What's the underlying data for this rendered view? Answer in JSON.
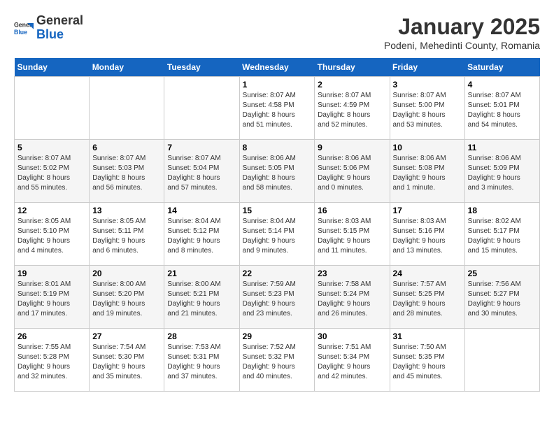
{
  "logo": {
    "general": "General",
    "blue": "Blue"
  },
  "title": "January 2025",
  "subtitle": "Podeni, Mehedinti County, Romania",
  "weekdays": [
    "Sunday",
    "Monday",
    "Tuesday",
    "Wednesday",
    "Thursday",
    "Friday",
    "Saturday"
  ],
  "weeks": [
    [
      {
        "day": "",
        "info": ""
      },
      {
        "day": "",
        "info": ""
      },
      {
        "day": "",
        "info": ""
      },
      {
        "day": "1",
        "info": "Sunrise: 8:07 AM\nSunset: 4:58 PM\nDaylight: 8 hours\nand 51 minutes."
      },
      {
        "day": "2",
        "info": "Sunrise: 8:07 AM\nSunset: 4:59 PM\nDaylight: 8 hours\nand 52 minutes."
      },
      {
        "day": "3",
        "info": "Sunrise: 8:07 AM\nSunset: 5:00 PM\nDaylight: 8 hours\nand 53 minutes."
      },
      {
        "day": "4",
        "info": "Sunrise: 8:07 AM\nSunset: 5:01 PM\nDaylight: 8 hours\nand 54 minutes."
      }
    ],
    [
      {
        "day": "5",
        "info": "Sunrise: 8:07 AM\nSunset: 5:02 PM\nDaylight: 8 hours\nand 55 minutes."
      },
      {
        "day": "6",
        "info": "Sunrise: 8:07 AM\nSunset: 5:03 PM\nDaylight: 8 hours\nand 56 minutes."
      },
      {
        "day": "7",
        "info": "Sunrise: 8:07 AM\nSunset: 5:04 PM\nDaylight: 8 hours\nand 57 minutes."
      },
      {
        "day": "8",
        "info": "Sunrise: 8:06 AM\nSunset: 5:05 PM\nDaylight: 8 hours\nand 58 minutes."
      },
      {
        "day": "9",
        "info": "Sunrise: 8:06 AM\nSunset: 5:06 PM\nDaylight: 9 hours\nand 0 minutes."
      },
      {
        "day": "10",
        "info": "Sunrise: 8:06 AM\nSunset: 5:08 PM\nDaylight: 9 hours\nand 1 minute."
      },
      {
        "day": "11",
        "info": "Sunrise: 8:06 AM\nSunset: 5:09 PM\nDaylight: 9 hours\nand 3 minutes."
      }
    ],
    [
      {
        "day": "12",
        "info": "Sunrise: 8:05 AM\nSunset: 5:10 PM\nDaylight: 9 hours\nand 4 minutes."
      },
      {
        "day": "13",
        "info": "Sunrise: 8:05 AM\nSunset: 5:11 PM\nDaylight: 9 hours\nand 6 minutes."
      },
      {
        "day": "14",
        "info": "Sunrise: 8:04 AM\nSunset: 5:12 PM\nDaylight: 9 hours\nand 8 minutes."
      },
      {
        "day": "15",
        "info": "Sunrise: 8:04 AM\nSunset: 5:14 PM\nDaylight: 9 hours\nand 9 minutes."
      },
      {
        "day": "16",
        "info": "Sunrise: 8:03 AM\nSunset: 5:15 PM\nDaylight: 9 hours\nand 11 minutes."
      },
      {
        "day": "17",
        "info": "Sunrise: 8:03 AM\nSunset: 5:16 PM\nDaylight: 9 hours\nand 13 minutes."
      },
      {
        "day": "18",
        "info": "Sunrise: 8:02 AM\nSunset: 5:17 PM\nDaylight: 9 hours\nand 15 minutes."
      }
    ],
    [
      {
        "day": "19",
        "info": "Sunrise: 8:01 AM\nSunset: 5:19 PM\nDaylight: 9 hours\nand 17 minutes."
      },
      {
        "day": "20",
        "info": "Sunrise: 8:00 AM\nSunset: 5:20 PM\nDaylight: 9 hours\nand 19 minutes."
      },
      {
        "day": "21",
        "info": "Sunrise: 8:00 AM\nSunset: 5:21 PM\nDaylight: 9 hours\nand 21 minutes."
      },
      {
        "day": "22",
        "info": "Sunrise: 7:59 AM\nSunset: 5:23 PM\nDaylight: 9 hours\nand 23 minutes."
      },
      {
        "day": "23",
        "info": "Sunrise: 7:58 AM\nSunset: 5:24 PM\nDaylight: 9 hours\nand 26 minutes."
      },
      {
        "day": "24",
        "info": "Sunrise: 7:57 AM\nSunset: 5:25 PM\nDaylight: 9 hours\nand 28 minutes."
      },
      {
        "day": "25",
        "info": "Sunrise: 7:56 AM\nSunset: 5:27 PM\nDaylight: 9 hours\nand 30 minutes."
      }
    ],
    [
      {
        "day": "26",
        "info": "Sunrise: 7:55 AM\nSunset: 5:28 PM\nDaylight: 9 hours\nand 32 minutes."
      },
      {
        "day": "27",
        "info": "Sunrise: 7:54 AM\nSunset: 5:30 PM\nDaylight: 9 hours\nand 35 minutes."
      },
      {
        "day": "28",
        "info": "Sunrise: 7:53 AM\nSunset: 5:31 PM\nDaylight: 9 hours\nand 37 minutes."
      },
      {
        "day": "29",
        "info": "Sunrise: 7:52 AM\nSunset: 5:32 PM\nDaylight: 9 hours\nand 40 minutes."
      },
      {
        "day": "30",
        "info": "Sunrise: 7:51 AM\nSunset: 5:34 PM\nDaylight: 9 hours\nand 42 minutes."
      },
      {
        "day": "31",
        "info": "Sunrise: 7:50 AM\nSunset: 5:35 PM\nDaylight: 9 hours\nand 45 minutes."
      },
      {
        "day": "",
        "info": ""
      }
    ]
  ]
}
